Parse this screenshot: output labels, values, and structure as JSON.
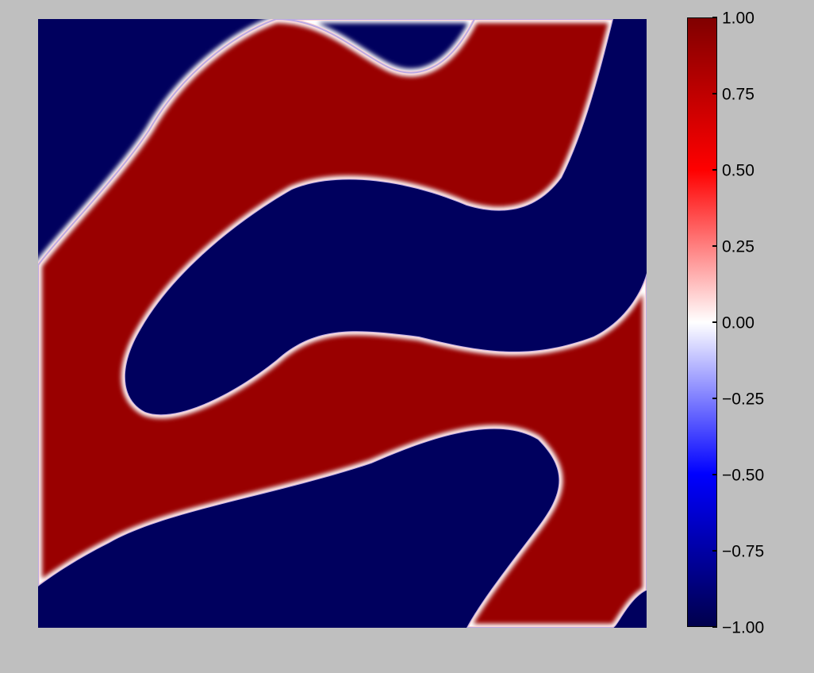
{
  "chart_data": {
    "type": "heatmap",
    "title": "",
    "xlabel": "",
    "ylabel": "",
    "colormap": "seismic",
    "colormap_stops": [
      {
        "value": -1.0,
        "color": "#00004c"
      },
      {
        "value": -0.5,
        "color": "#0000ff"
      },
      {
        "value": 0.0,
        "color": "#ffffff"
      },
      {
        "value": 0.5,
        "color": "#ff0000"
      },
      {
        "value": 1.0,
        "color": "#800000"
      }
    ],
    "value_range": [
      -1.0,
      1.0
    ],
    "field_levels": {
      "positive_phase": 0.9,
      "negative_phase": -0.95
    },
    "colorbar": {
      "position": "right",
      "ticks": [
        1.0,
        0.75,
        0.5,
        0.25,
        0.0,
        -0.25,
        -0.5,
        -0.75,
        -1.0
      ],
      "tick_labels": [
        "1.00",
        "0.75",
        "0.50",
        "0.25",
        "0.00",
        "−0.25",
        "−0.50",
        "−0.75",
        "−1.00"
      ]
    },
    "regions": [
      {
        "phase": "negative",
        "label": "top-left corner region"
      },
      {
        "phase": "positive",
        "label": "upper red band"
      },
      {
        "phase": "negative",
        "label": "central blue band"
      },
      {
        "phase": "positive",
        "label": "lower red band"
      },
      {
        "phase": "negative",
        "label": "bottom blue region"
      },
      {
        "phase": "negative",
        "label": "bottom-right corner region"
      }
    ]
  }
}
